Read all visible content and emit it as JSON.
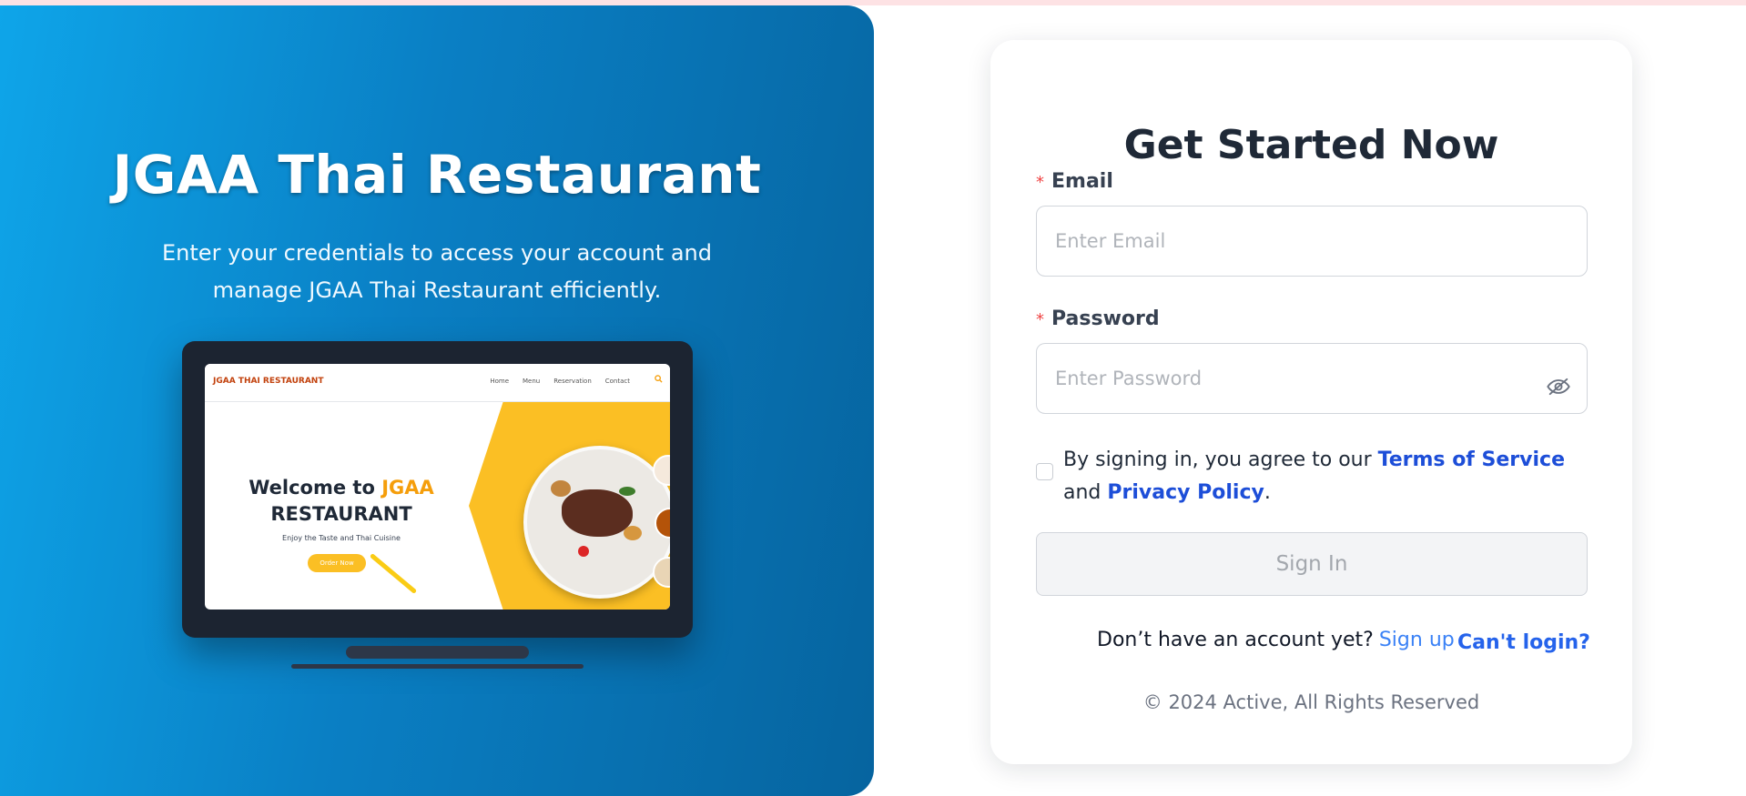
{
  "hero": {
    "title": "JGAA Thai Restaurant",
    "subtitle": "Enter your credentials to access your account and manage JGAA Thai Restaurant efficiently.",
    "preview": {
      "brand": "JGAA THAI RESTAURANT",
      "nav_links": [
        "Home",
        "Menu",
        "Reservation",
        "Contact"
      ],
      "welcome_prefix": "Welcome to ",
      "welcome_highlight": "JGAA",
      "welcome_line2": "RESTAURANT",
      "tagline": "Enjoy the Taste and Thai Cuisine",
      "order_button": "Order Now"
    }
  },
  "card": {
    "title": "Get Started Now",
    "email": {
      "required_mark": "*",
      "label": "Email",
      "placeholder": "Enter Email",
      "value": ""
    },
    "password": {
      "required_mark": "*",
      "label": "Password",
      "placeholder": "Enter Password",
      "value": ""
    },
    "agreement": {
      "checked": false,
      "text_before": "By signing in, you agree to our ",
      "terms_link": "Terms of Service",
      "text_middle": " and ",
      "privacy_link": "Privacy Policy",
      "text_after": "."
    },
    "signin_button": "Sign In",
    "no_account_text": "Don’t have an account yet?",
    "signup_link": "Sign up",
    "cant_login_link": "Can't login?",
    "copyright": "© 2024 Active, All Rights Reserved"
  },
  "colors": {
    "hero_gradient_start": "#0ea5e9",
    "hero_gradient_end": "#06649f",
    "link_blue": "#1d4ed8",
    "required_red": "#ef4444",
    "accent_yellow": "#fbbf24"
  },
  "icons": {
    "password_toggle": "eye-off-icon",
    "preview_search": "search-icon"
  }
}
